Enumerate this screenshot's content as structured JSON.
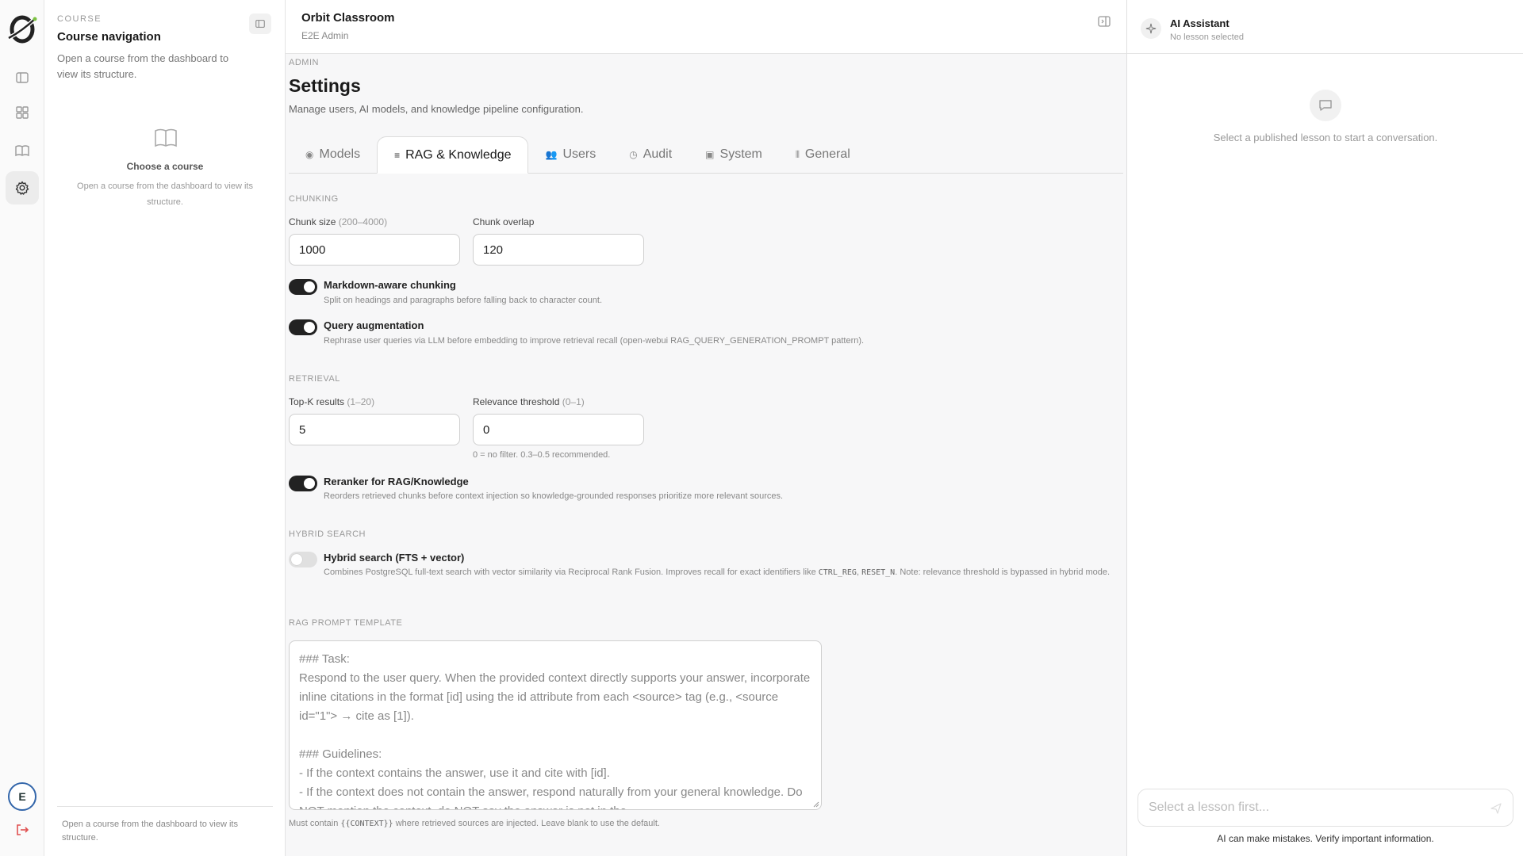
{
  "course_panel": {
    "eyebrow": "COURSE",
    "title": "Course navigation",
    "subtitle": "Open a course from the dashboard to view its structure.",
    "empty_title": "Choose a course",
    "empty_subtitle": "Open a course from the dashboard to view its structure.",
    "footer": "Open a course from the dashboard to view its structure."
  },
  "user": {
    "initial": "E"
  },
  "topbar": {
    "title": "Orbit Classroom",
    "subtitle": "E2E Admin"
  },
  "page": {
    "eyebrow": "ADMIN",
    "title": "Settings",
    "subtitle": "Manage users, AI models, and knowledge pipeline configuration."
  },
  "tabs": [
    {
      "label": "Models",
      "icon": "chip-icon",
      "glyph": "◉"
    },
    {
      "label": "RAG & Knowledge",
      "icon": "database-icon",
      "glyph": "≡"
    },
    {
      "label": "Users",
      "icon": "users-icon",
      "glyph": "👥"
    },
    {
      "label": "Audit",
      "icon": "clock-icon",
      "glyph": "◷"
    },
    {
      "label": "System",
      "icon": "server-icon",
      "glyph": "▣"
    },
    {
      "label": "General",
      "icon": "sliders-icon",
      "glyph": "⫴"
    }
  ],
  "active_tab": "RAG & Knowledge",
  "chunking": {
    "section": "CHUNKING",
    "chunk_size_label": "Chunk size",
    "chunk_size_hint": "(200–4000)",
    "chunk_size_value": "1000",
    "chunk_overlap_label": "Chunk overlap",
    "chunk_overlap_value": "120",
    "markdown_title": "Markdown-aware chunking",
    "markdown_desc": "Split on headings and paragraphs before falling back to character count.",
    "markdown_on": true,
    "query_title": "Query augmentation",
    "query_desc": "Rephrase user queries via LLM before embedding to improve retrieval recall (open-webui RAG_QUERY_GENERATION_PROMPT pattern).",
    "query_on": true
  },
  "retrieval": {
    "section": "RETRIEVAL",
    "topk_label": "Top-K results",
    "topk_hint": "(1–20)",
    "topk_value": "5",
    "threshold_label": "Relevance threshold",
    "threshold_hint": "(0–1)",
    "threshold_value": "0",
    "threshold_help": "0 = no filter. 0.3–0.5 recommended.",
    "reranker_title": "Reranker for RAG/Knowledge",
    "reranker_desc": "Reorders retrieved chunks before context injection so knowledge-grounded responses prioritize more relevant sources.",
    "reranker_on": true
  },
  "hybrid": {
    "section": "HYBRID SEARCH",
    "title": "Hybrid search (FTS + vector)",
    "desc_a": "Combines PostgreSQL full-text search with vector similarity via Reciprocal Rank Fusion. Improves recall for exact identifiers like ",
    "code_a": "CTRL_REG",
    "desc_b": ", ",
    "code_b": "RESET_N",
    "desc_c": ". Note: relevance threshold is bypassed in hybrid mode.",
    "on": false
  },
  "prompt": {
    "section": "RAG PROMPT TEMPLATE",
    "placeholder": "### Task:\nRespond to the user query. When the provided context directly supports your answer, incorporate inline citations in the format [id] using the id attribute from each <source> tag (e.g., <source id=\"1\"> → cite as [1]).\n\n### Guidelines:\n- If the context contains the answer, use it and cite with [id].\n- If the context does not contain the answer, respond naturally from your general knowledge. Do NOT mention the context, do NOT say the answer is not in the",
    "help_a": "Must contain ",
    "help_code": "{{CONTEXT}}",
    "help_b": " where retrieved sources are injected. Leave blank to use the default."
  },
  "assistant": {
    "title": "AI Assistant",
    "subtitle": "No lesson selected",
    "empty": "Select a published lesson to start a conversation.",
    "input_placeholder": "Select a lesson first...",
    "disclaimer": "AI can make mistakes. Verify important information."
  },
  "colors": {
    "toggle_on": "#222222",
    "toggle_off": "#e0e0e0",
    "avatar_ring": "#3366aa",
    "logo_accent": "#7cc242",
    "logout": "#e05050"
  }
}
